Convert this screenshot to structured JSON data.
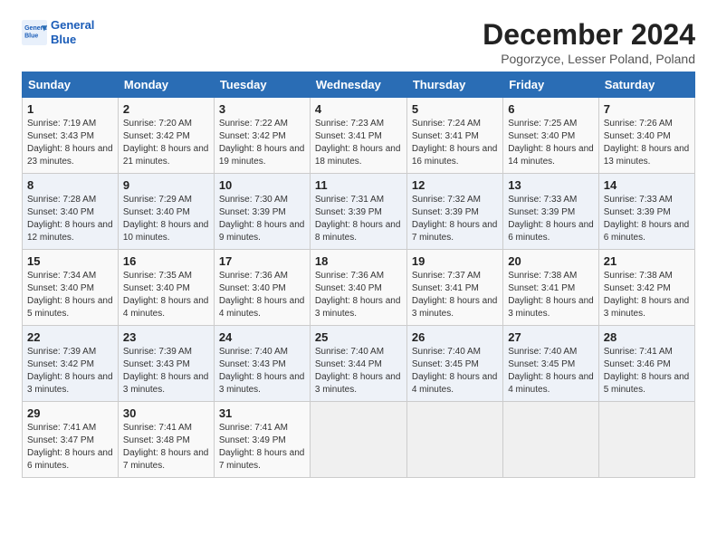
{
  "header": {
    "logo_line1": "General",
    "logo_line2": "Blue",
    "main_title": "December 2024",
    "subtitle": "Pogorzyce, Lesser Poland, Poland"
  },
  "weekdays": [
    "Sunday",
    "Monday",
    "Tuesday",
    "Wednesday",
    "Thursday",
    "Friday",
    "Saturday"
  ],
  "weeks": [
    [
      {
        "day": "1",
        "sunrise": "7:19 AM",
        "sunset": "3:43 PM",
        "daylight": "8 hours and 23 minutes."
      },
      {
        "day": "2",
        "sunrise": "7:20 AM",
        "sunset": "3:42 PM",
        "daylight": "8 hours and 21 minutes."
      },
      {
        "day": "3",
        "sunrise": "7:22 AM",
        "sunset": "3:42 PM",
        "daylight": "8 hours and 19 minutes."
      },
      {
        "day": "4",
        "sunrise": "7:23 AM",
        "sunset": "3:41 PM",
        "daylight": "8 hours and 18 minutes."
      },
      {
        "day": "5",
        "sunrise": "7:24 AM",
        "sunset": "3:41 PM",
        "daylight": "8 hours and 16 minutes."
      },
      {
        "day": "6",
        "sunrise": "7:25 AM",
        "sunset": "3:40 PM",
        "daylight": "8 hours and 14 minutes."
      },
      {
        "day": "7",
        "sunrise": "7:26 AM",
        "sunset": "3:40 PM",
        "daylight": "8 hours and 13 minutes."
      }
    ],
    [
      {
        "day": "8",
        "sunrise": "7:28 AM",
        "sunset": "3:40 PM",
        "daylight": "8 hours and 12 minutes."
      },
      {
        "day": "9",
        "sunrise": "7:29 AM",
        "sunset": "3:40 PM",
        "daylight": "8 hours and 10 minutes."
      },
      {
        "day": "10",
        "sunrise": "7:30 AM",
        "sunset": "3:39 PM",
        "daylight": "8 hours and 9 minutes."
      },
      {
        "day": "11",
        "sunrise": "7:31 AM",
        "sunset": "3:39 PM",
        "daylight": "8 hours and 8 minutes."
      },
      {
        "day": "12",
        "sunrise": "7:32 AM",
        "sunset": "3:39 PM",
        "daylight": "8 hours and 7 minutes."
      },
      {
        "day": "13",
        "sunrise": "7:33 AM",
        "sunset": "3:39 PM",
        "daylight": "8 hours and 6 minutes."
      },
      {
        "day": "14",
        "sunrise": "7:33 AM",
        "sunset": "3:39 PM",
        "daylight": "8 hours and 6 minutes."
      }
    ],
    [
      {
        "day": "15",
        "sunrise": "7:34 AM",
        "sunset": "3:40 PM",
        "daylight": "8 hours and 5 minutes."
      },
      {
        "day": "16",
        "sunrise": "7:35 AM",
        "sunset": "3:40 PM",
        "daylight": "8 hours and 4 minutes."
      },
      {
        "day": "17",
        "sunrise": "7:36 AM",
        "sunset": "3:40 PM",
        "daylight": "8 hours and 4 minutes."
      },
      {
        "day": "18",
        "sunrise": "7:36 AM",
        "sunset": "3:40 PM",
        "daylight": "8 hours and 3 minutes."
      },
      {
        "day": "19",
        "sunrise": "7:37 AM",
        "sunset": "3:41 PM",
        "daylight": "8 hours and 3 minutes."
      },
      {
        "day": "20",
        "sunrise": "7:38 AM",
        "sunset": "3:41 PM",
        "daylight": "8 hours and 3 minutes."
      },
      {
        "day": "21",
        "sunrise": "7:38 AM",
        "sunset": "3:42 PM",
        "daylight": "8 hours and 3 minutes."
      }
    ],
    [
      {
        "day": "22",
        "sunrise": "7:39 AM",
        "sunset": "3:42 PM",
        "daylight": "8 hours and 3 minutes."
      },
      {
        "day": "23",
        "sunrise": "7:39 AM",
        "sunset": "3:43 PM",
        "daylight": "8 hours and 3 minutes."
      },
      {
        "day": "24",
        "sunrise": "7:40 AM",
        "sunset": "3:43 PM",
        "daylight": "8 hours and 3 minutes."
      },
      {
        "day": "25",
        "sunrise": "7:40 AM",
        "sunset": "3:44 PM",
        "daylight": "8 hours and 3 minutes."
      },
      {
        "day": "26",
        "sunrise": "7:40 AM",
        "sunset": "3:45 PM",
        "daylight": "8 hours and 4 minutes."
      },
      {
        "day": "27",
        "sunrise": "7:40 AM",
        "sunset": "3:45 PM",
        "daylight": "8 hours and 4 minutes."
      },
      {
        "day": "28",
        "sunrise": "7:41 AM",
        "sunset": "3:46 PM",
        "daylight": "8 hours and 5 minutes."
      }
    ],
    [
      {
        "day": "29",
        "sunrise": "7:41 AM",
        "sunset": "3:47 PM",
        "daylight": "8 hours and 6 minutes."
      },
      {
        "day": "30",
        "sunrise": "7:41 AM",
        "sunset": "3:48 PM",
        "daylight": "8 hours and 7 minutes."
      },
      {
        "day": "31",
        "sunrise": "7:41 AM",
        "sunset": "3:49 PM",
        "daylight": "8 hours and 7 minutes."
      },
      null,
      null,
      null,
      null
    ]
  ]
}
